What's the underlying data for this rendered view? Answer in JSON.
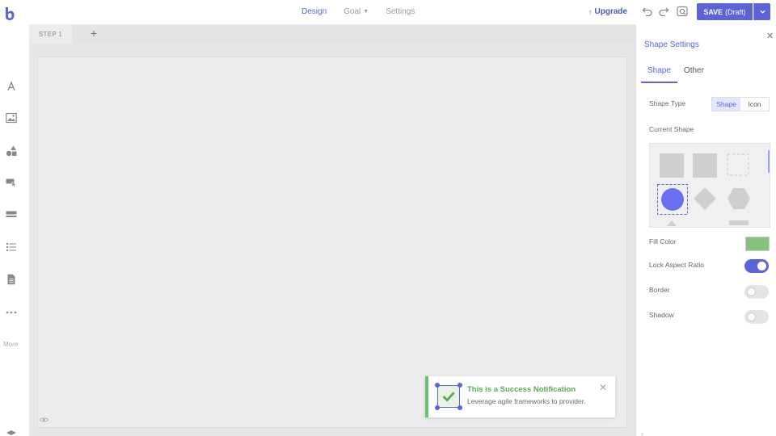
{
  "topbar": {
    "nav": [
      {
        "label": "Design",
        "active": true
      },
      {
        "label": "Goal",
        "active": false,
        "has_caret": true
      },
      {
        "label": "Settings",
        "active": false
      }
    ],
    "upgrade_label": "Upgrade",
    "save_label": "SAVE",
    "save_state": "(Draft)",
    "icons": [
      "undo-icon",
      "redo-icon",
      "preview-icon",
      "chevron-down-icon"
    ]
  },
  "left_toolbar": {
    "items": [
      "text-icon",
      "image-icon",
      "shapes-icon",
      "button-icon",
      "form-icon",
      "list-icon",
      "page-icon",
      "more-icon"
    ],
    "more_label": "More"
  },
  "steps": {
    "tabs": [
      {
        "label": "STEP 1"
      }
    ],
    "add_label": "+"
  },
  "notification": {
    "title": "This is a Success Notification",
    "message": "Leverage agile frameworks to provider.",
    "close": "✕"
  },
  "panel": {
    "title": "Shape Settings",
    "close": "✕",
    "tabs": [
      {
        "label": "Shape",
        "active": true
      },
      {
        "label": "Other",
        "active": false
      }
    ],
    "shape_type_label": "Shape Type",
    "shape_type_options": [
      {
        "label": "Shape",
        "active": true
      },
      {
        "label": "Icon",
        "active": false
      }
    ],
    "current_shape_label": "Current Shape",
    "fill_color_label": "Fill Color",
    "fill_color": "#88c27f",
    "lock_aspect_label": "Lock Aspect Ratio",
    "lock_aspect": true,
    "border_label": "Border",
    "border": false,
    "shadow_label": "Shadow",
    "shadow": false
  },
  "colors": {
    "accent": "#5b63d9",
    "success": "#6cc070"
  }
}
